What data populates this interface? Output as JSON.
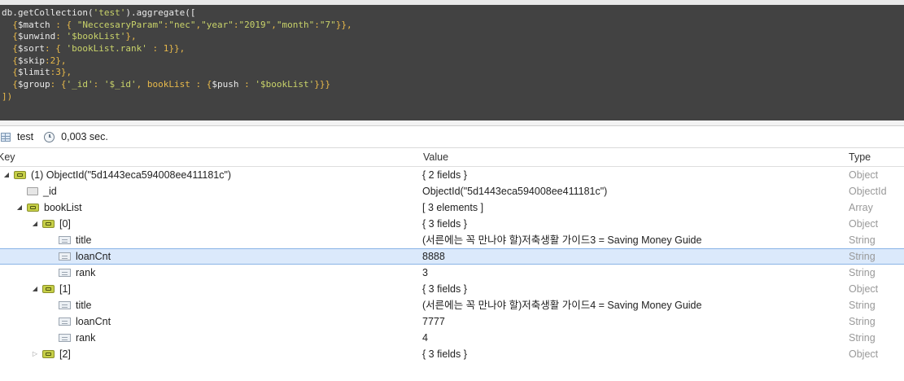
{
  "editor": {
    "lines": [
      [
        {
          "t": "db.getCollection(",
          "c": "plain"
        },
        {
          "t": "'test'",
          "c": "str"
        },
        {
          "t": ").aggregate([",
          "c": "plain"
        }
      ],
      [
        {
          "t": "  {",
          "c": "punct"
        },
        {
          "t": "$match",
          "c": "key"
        },
        {
          "t": " : { ",
          "c": "punct"
        },
        {
          "t": "\"NeccesaryParam\"",
          "c": "str"
        },
        {
          "t": ":",
          "c": "punct"
        },
        {
          "t": "\"nec\"",
          "c": "str"
        },
        {
          "t": ",",
          "c": "punct"
        },
        {
          "t": "\"year\"",
          "c": "str"
        },
        {
          "t": ":",
          "c": "punct"
        },
        {
          "t": "\"2019\"",
          "c": "str"
        },
        {
          "t": ",",
          "c": "punct"
        },
        {
          "t": "\"month\"",
          "c": "str"
        },
        {
          "t": ":",
          "c": "punct"
        },
        {
          "t": "\"7\"",
          "c": "str"
        },
        {
          "t": "}},",
          "c": "punct"
        }
      ],
      [
        {
          "t": "  {",
          "c": "punct"
        },
        {
          "t": "$unwind",
          "c": "key"
        },
        {
          "t": ": ",
          "c": "punct"
        },
        {
          "t": "'$bookList'",
          "c": "str"
        },
        {
          "t": "},",
          "c": "punct"
        }
      ],
      [
        {
          "t": "  {",
          "c": "punct"
        },
        {
          "t": "$sort",
          "c": "key"
        },
        {
          "t": ": { ",
          "c": "punct"
        },
        {
          "t": "'bookList.rank'",
          "c": "str"
        },
        {
          "t": " : 1}},",
          "c": "punct"
        }
      ],
      [
        {
          "t": "  {",
          "c": "punct"
        },
        {
          "t": "$skip",
          "c": "key"
        },
        {
          "t": ":2},",
          "c": "punct"
        }
      ],
      [
        {
          "t": "  {",
          "c": "punct"
        },
        {
          "t": "$limit",
          "c": "key"
        },
        {
          "t": ":3},",
          "c": "punct"
        }
      ],
      [
        {
          "t": "  {",
          "c": "punct"
        },
        {
          "t": "$group",
          "c": "key"
        },
        {
          "t": ": {",
          "c": "punct"
        },
        {
          "t": "'_id'",
          "c": "str"
        },
        {
          "t": ": ",
          "c": "punct"
        },
        {
          "t": "'$_id'",
          "c": "str"
        },
        {
          "t": ", bookList : {",
          "c": "punct"
        },
        {
          "t": "$push",
          "c": "key"
        },
        {
          "t": " : ",
          "c": "punct"
        },
        {
          "t": "'$bookList'",
          "c": "str"
        },
        {
          "t": "}}}",
          "c": "punct"
        }
      ],
      [
        {
          "t": "])",
          "c": "punct"
        }
      ]
    ]
  },
  "toolbar": {
    "collection": "test",
    "time": "0,003 sec."
  },
  "columns": {
    "key": "Key",
    "value": "Value",
    "type": "Type"
  },
  "rows": [
    {
      "indent": 0,
      "arrow": "expanded",
      "icon": "object",
      "key": "(1) ObjectId(\"5d1443eca594008ee411181c\")",
      "value": "{ 2 fields }",
      "type": "Object"
    },
    {
      "indent": 1,
      "arrow": "none",
      "icon": "id",
      "key": "_id",
      "value": "ObjectId(\"5d1443eca594008ee411181c\")",
      "type": "ObjectId"
    },
    {
      "indent": 1,
      "arrow": "expanded",
      "icon": "object",
      "key": "bookList",
      "value": "[ 3 elements ]",
      "type": "Array"
    },
    {
      "indent": 2,
      "arrow": "expanded",
      "icon": "object",
      "key": "[0]",
      "value": "{ 3 fields }",
      "type": "Object"
    },
    {
      "indent": 3,
      "arrow": "none",
      "icon": "field",
      "key": "title",
      "value": "(서른에는 꼭 만나야 할)저축생활 가이드3 = Saving Money Guide",
      "type": "String"
    },
    {
      "indent": 3,
      "arrow": "none",
      "icon": "field",
      "key": "loanCnt",
      "value": "8888",
      "type": "String",
      "selected": true
    },
    {
      "indent": 3,
      "arrow": "none",
      "icon": "field",
      "key": "rank",
      "value": "3",
      "type": "String"
    },
    {
      "indent": 2,
      "arrow": "expanded",
      "icon": "object",
      "key": "[1]",
      "value": "{ 3 fields }",
      "type": "Object"
    },
    {
      "indent": 3,
      "arrow": "none",
      "icon": "field",
      "key": "title",
      "value": "(서른에는 꼭 만나야 할)저축생활 가이드4 = Saving Money Guide",
      "type": "String"
    },
    {
      "indent": 3,
      "arrow": "none",
      "icon": "field",
      "key": "loanCnt",
      "value": "7777",
      "type": "String"
    },
    {
      "indent": 3,
      "arrow": "none",
      "icon": "field",
      "key": "rank",
      "value": "4",
      "type": "String"
    },
    {
      "indent": 2,
      "arrow": "collapsed",
      "icon": "object",
      "key": "[2]",
      "value": "{ 3 fields }",
      "type": "Object"
    }
  ]
}
